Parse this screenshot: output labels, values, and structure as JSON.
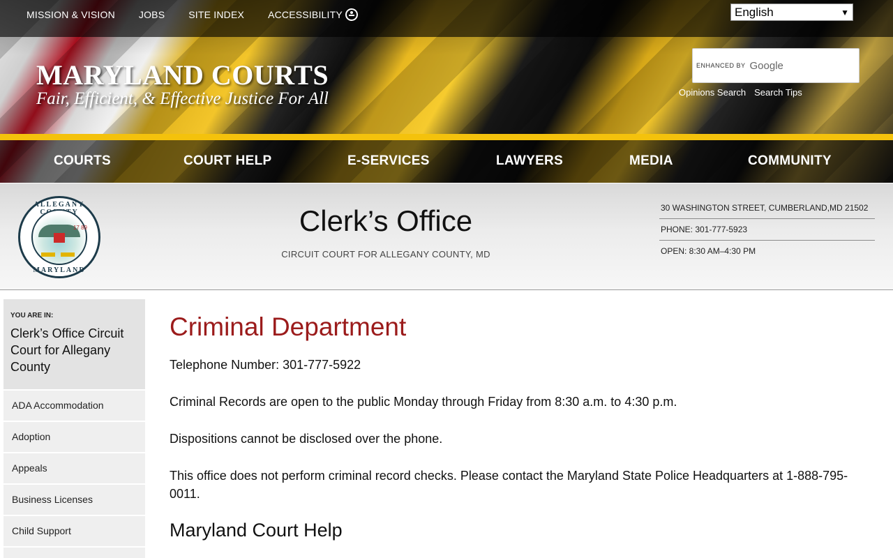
{
  "topbar": {
    "links": [
      "MISSION & VISION",
      "JOBS",
      "SITE INDEX",
      "ACCESSIBILITY"
    ],
    "language": "English"
  },
  "brand": {
    "title": "MARYLAND COURTS",
    "tagline": "Fair, Efficient, & Effective Justice For All"
  },
  "search": {
    "enhanced_by": "ENHANCED BY",
    "google": "Google",
    "links": [
      "Opinions Search",
      "Search Tips"
    ]
  },
  "nav": {
    "items": [
      "COURTS",
      "COURT HELP",
      "E-SERVICES",
      "LAWYERS",
      "MEDIA",
      "COMMUNITY"
    ]
  },
  "office": {
    "title": "Clerk’s Office",
    "subtitle": "CIRCUIT COURT FOR ALLEGANY COUNTY, MD",
    "address": "30 WASHINGTON STREET, CUMBERLAND,MD 21502",
    "phone": "PHONE: 301-777-5923",
    "hours": "OPEN: 8:30 AM–4:30 PM",
    "seal_top": "ALLEGANY COUNTY",
    "seal_bottom": "MARYLAND",
    "seal_year": "17 89"
  },
  "sidebar": {
    "you_are_in_label": "YOU ARE IN:",
    "breadcrumb": "Clerk’s Office Circuit Court for Allegany County",
    "items": [
      "ADA Accommodation",
      "Adoption",
      "Appeals",
      "Business Licenses",
      "Child Support"
    ]
  },
  "content": {
    "heading": "Criminal Department",
    "telephone": "Telephone Number: 301-777-5922",
    "records_hours": "Criminal Records are open to the public Monday through Friday from 8:30 a.m. to 4:30 p.m.",
    "dispositions": "Dispositions cannot be disclosed over the phone.",
    "record_checks": "This office does not perform criminal record checks. Please contact the Maryland State Police Headquarters at 1-888-795-0011.",
    "subheading": "Maryland Court Help"
  }
}
